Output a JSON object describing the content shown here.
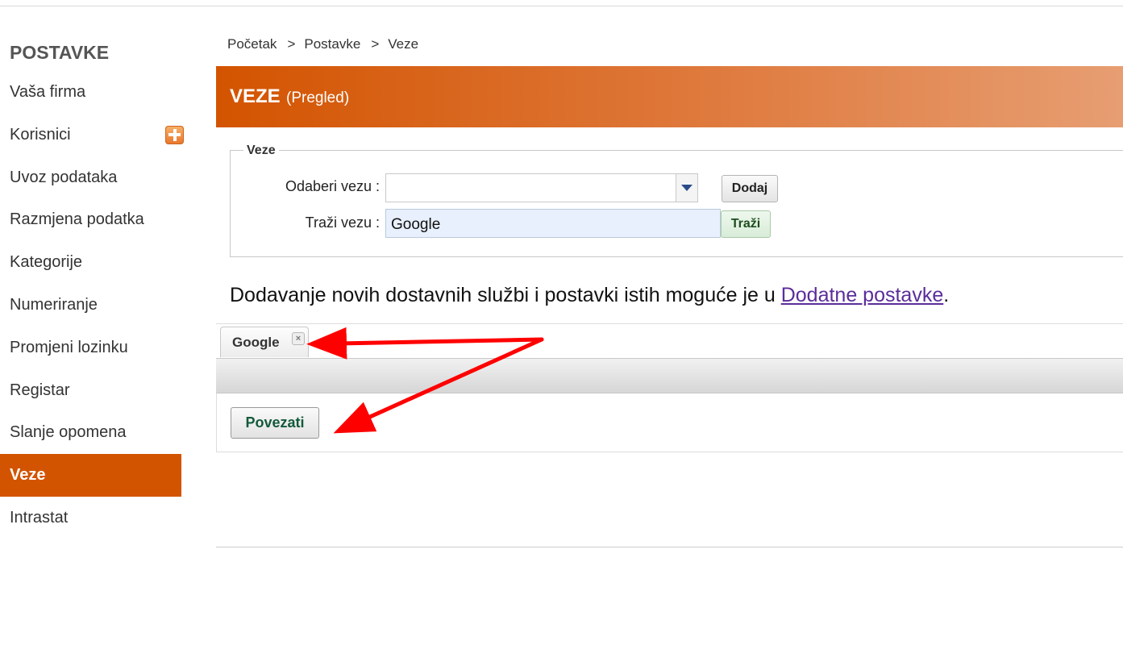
{
  "sidebar": {
    "title": "POSTAVKE",
    "items": [
      {
        "label": "Vaša firma"
      },
      {
        "label": "Korisnici"
      },
      {
        "label": "Uvoz podataka"
      },
      {
        "label": "Razmjena podatka"
      },
      {
        "label": "Kategorije"
      },
      {
        "label": "Numeriranje"
      },
      {
        "label": "Promjeni lozinku"
      },
      {
        "label": "Registar"
      },
      {
        "label": "Slanje opomena"
      },
      {
        "label": "Veze"
      },
      {
        "label": "Intrastat"
      }
    ],
    "active": "Veze"
  },
  "breadcrumb": {
    "items": [
      "Početak",
      "Postavke",
      "Veze"
    ],
    "separator": ">"
  },
  "header": {
    "title": "VEZE",
    "subtitle": "(Pregled)",
    "accent": "#d35400"
  },
  "form": {
    "legend": "Veze",
    "select_label": "Odaberi vezu :",
    "select_value": "",
    "add_button": "Dodaj",
    "search_label": "Traži vezu :",
    "search_value": "Google",
    "search_button": "Traži"
  },
  "info": {
    "text": "Dodavanje novih dostavnih službi i postavki istih moguće je u ",
    "link": "Dodatne postavke",
    "end": "."
  },
  "tabs": [
    {
      "label": "Google",
      "close_icon": "close-icon"
    }
  ],
  "panel": {
    "connect_button": "Povezati"
  },
  "annotation": {
    "arrow_color": "#ff0000"
  }
}
